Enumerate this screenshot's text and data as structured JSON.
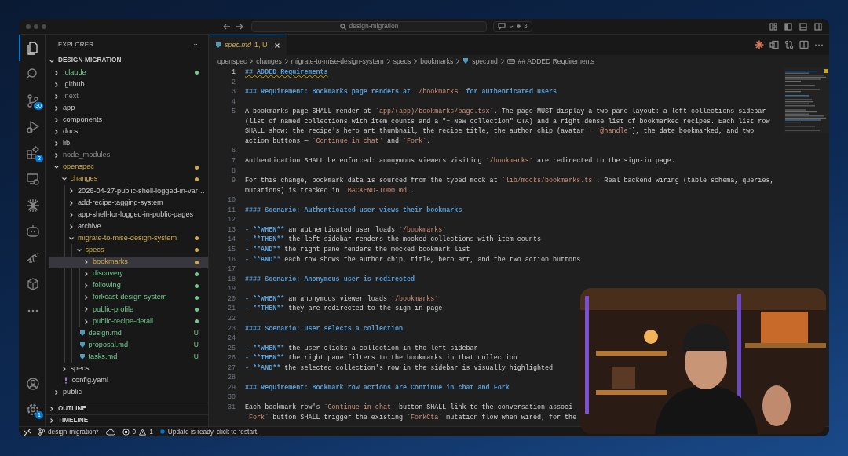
{
  "title_bar": {
    "search": "design-migration",
    "chat_count": "3"
  },
  "activity_bar": {
    "items": [
      {
        "selected": true
      },
      {
        "selected": false
      },
      {
        "selected": false,
        "badge": "30"
      },
      {
        "selected": false
      },
      {
        "selected": false,
        "badge": "2"
      },
      {
        "selected": false
      },
      {
        "selected": false
      },
      {
        "selected": false
      },
      {
        "selected": false
      },
      {
        "selected": false
      },
      {
        "selected": false
      }
    ],
    "bottom": [
      {
        "selected": false
      },
      {
        "selected": false,
        "badge": "1"
      }
    ]
  },
  "sidebar": {
    "title": "EXPLORER",
    "more": "···",
    "sections": [
      {
        "title": "DESIGN-MIGRATION",
        "expanded": true,
        "tree": [
          {
            "label": ".claude",
            "kind": "folder",
            "expanded": false,
            "selected": false,
            "color": "#73c991",
            "dot": true
          },
          {
            "label": ".github",
            "kind": "folder",
            "expanded": false,
            "selected": false
          },
          {
            "label": ".next",
            "kind": "folder",
            "expanded": false,
            "selected": false,
            "dimmed": true
          },
          {
            "label": "app",
            "kind": "folder",
            "expanded": false,
            "selected": false
          },
          {
            "label": "components",
            "kind": "folder",
            "expanded": false,
            "selected": false
          },
          {
            "label": "docs",
            "kind": "folder",
            "expanded": false,
            "selected": false
          },
          {
            "label": "lib",
            "kind": "folder",
            "expanded": false,
            "selected": false
          },
          {
            "label": "node_modules",
            "kind": "folder",
            "expanded": false,
            "selected": false,
            "dimmed": true
          },
          {
            "label": "openspec",
            "kind": "folder",
            "expanded": true,
            "selected": false,
            "color": "#d1ad4f",
            "dot": true,
            "children": [
              {
                "label": "changes",
                "kind": "folder",
                "expanded": true,
                "selected": false,
                "color": "#d1ad4f",
                "dot": true,
                "children": [
                  {
                    "label": "2026-04-27-public-shell-logged-in-var…",
                    "kind": "folder",
                    "expanded": false,
                    "selected": false
                  },
                  {
                    "label": "add-recipe-tagging-system",
                    "kind": "folder",
                    "expanded": false,
                    "selected": false
                  },
                  {
                    "label": "app-shell-for-logged-in-public-pages",
                    "kind": "folder",
                    "expanded": false,
                    "selected": false
                  },
                  {
                    "label": "archive",
                    "kind": "folder",
                    "expanded": false,
                    "selected": false
                  },
                  {
                    "label": "migrate-to-mise-design-system",
                    "kind": "folder",
                    "expanded": true,
                    "selected": false,
                    "color": "#d1ad4f",
                    "dot": true,
                    "children": [
                      {
                        "label": "specs",
                        "kind": "folder",
                        "expanded": true,
                        "selected": false,
                        "color": "#d1ad4f",
                        "dot": true,
                        "children": [
                          {
                            "label": "bookmarks",
                            "kind": "folder",
                            "expanded": false,
                            "selected": true,
                            "color": "#d1ad4f",
                            "dot": true
                          },
                          {
                            "label": "discovery",
                            "kind": "folder",
                            "expanded": false,
                            "selected": false,
                            "color": "#73c991",
                            "dot": true
                          },
                          {
                            "label": "following",
                            "kind": "folder",
                            "expanded": false,
                            "selected": false,
                            "color": "#73c991",
                            "dot": true
                          },
                          {
                            "label": "forkcast-design-system",
                            "kind": "folder",
                            "expanded": false,
                            "selected": false,
                            "color": "#73c991",
                            "dot": true
                          },
                          {
                            "label": "public-profile",
                            "kind": "folder",
                            "expanded": false,
                            "selected": false,
                            "color": "#73c991",
                            "dot": true
                          },
                          {
                            "label": "public-recipe-detail",
                            "kind": "folder",
                            "expanded": false,
                            "selected": false,
                            "color": "#73c991",
                            "dot": true
                          }
                        ]
                      },
                      {
                        "label": "design.md",
                        "kind": "markdown",
                        "selected": false,
                        "badge": "U"
                      },
                      {
                        "label": "proposal.md",
                        "kind": "markdown",
                        "selected": false,
                        "badge": "U"
                      },
                      {
                        "label": "tasks.md",
                        "kind": "markdown",
                        "selected": false,
                        "badge": "U"
                      }
                    ]
                  }
                ]
              },
              {
                "label": "specs",
                "kind": "folder",
                "expanded": false,
                "selected": false
              },
              {
                "label": "config.yaml",
                "kind": "yaml",
                "selected": false
              }
            ]
          },
          {
            "label": "public",
            "kind": "folder",
            "expanded": false,
            "selected": false
          }
        ]
      },
      {
        "title": "OUTLINE",
        "expanded": false
      },
      {
        "title": "TIMELINE",
        "expanded": false
      }
    ]
  },
  "editor": {
    "tabs": [
      {
        "label": "spec.md",
        "status": "1, U",
        "selected": true
      }
    ],
    "breadcrumbs": [
      {
        "label": "openspec",
        "kind": "folder"
      },
      {
        "label": "changes",
        "kind": "folder"
      },
      {
        "label": "migrate-to-mise-design-system",
        "kind": "folder"
      },
      {
        "label": "specs",
        "kind": "folder"
      },
      {
        "label": "bookmarks",
        "kind": "folder"
      },
      {
        "label": "spec.md",
        "kind": "markdown"
      },
      {
        "label": "## ADDED Requirements",
        "kind": "symbol"
      }
    ],
    "lines": [
      {
        "number": "1",
        "current": true,
        "warning": true,
        "rows": [
          {
            "parts": [
              {
                "kind": "heading",
                "text": "## ADDED Requirements"
              }
            ]
          }
        ]
      },
      {
        "number": "2",
        "current": false,
        "rows": [
          {
            "parts": []
          }
        ]
      },
      {
        "number": "3",
        "current": false,
        "rows": [
          {
            "parts": [
              {
                "kind": "heading",
                "text": "### Requirement: Bookmarks page renders at "
              },
              {
                "kind": "code",
                "text": "`/bookmarks`"
              },
              {
                "kind": "heading",
                "text": " for authenticated users"
              }
            ]
          }
        ]
      },
      {
        "number": "4",
        "current": false,
        "rows": [
          {
            "parts": []
          }
        ]
      },
      {
        "number": "5",
        "current": false,
        "rows": [
          {
            "parts": [
              {
                "kind": "text",
                "text": "A bookmarks page SHALL render at "
              },
              {
                "kind": "code",
                "text": "`app/(app)/bookmarks/page.tsx`"
              },
              {
                "kind": "text",
                "text": ". The page MUST display a two-pane layout: a left collections sidebar"
              }
            ]
          },
          {
            "parts": [
              {
                "kind": "text",
                "text": "(list of named collections with item counts and a \"+ New collection\" CTA) and a right dense list of bookmarked recipes. Each list row"
              }
            ]
          },
          {
            "parts": [
              {
                "kind": "text",
                "text": "SHALL show: the recipe's hero art thumbnail, the recipe title, the author chip (avatar + "
              },
              {
                "kind": "code",
                "text": "`@handle`"
              },
              {
                "kind": "text",
                "text": "), the date bookmarked, and two"
              }
            ]
          },
          {
            "parts": [
              {
                "kind": "text",
                "text": "action buttons — "
              },
              {
                "kind": "code",
                "text": "`Continue in chat`"
              },
              {
                "kind": "text",
                "text": " and "
              },
              {
                "kind": "code",
                "text": "`Fork`"
              },
              {
                "kind": "text",
                "text": "."
              }
            ]
          }
        ]
      },
      {
        "number": "6",
        "current": false,
        "rows": [
          {
            "parts": []
          }
        ]
      },
      {
        "number": "7",
        "current": false,
        "rows": [
          {
            "parts": [
              {
                "kind": "text",
                "text": "Authentication SHALL be enforced: anonymous viewers visiting "
              },
              {
                "kind": "code",
                "text": "`/bookmarks`"
              },
              {
                "kind": "text",
                "text": " are redirected to the sign-in page."
              }
            ]
          }
        ]
      },
      {
        "number": "8",
        "current": false,
        "rows": [
          {
            "parts": []
          }
        ]
      },
      {
        "number": "9",
        "current": false,
        "rows": [
          {
            "parts": [
              {
                "kind": "text",
                "text": "For this change, bookmark data is sourced from the typed mock at "
              },
              {
                "kind": "code",
                "text": "`lib/mocks/bookmarks.ts`"
              },
              {
                "kind": "text",
                "text": ". Real backend wiring (table schema, queries,"
              }
            ]
          },
          {
            "parts": [
              {
                "kind": "text",
                "text": "mutations) is tracked in "
              },
              {
                "kind": "code",
                "text": "`BACKEND-TODO.md`"
              },
              {
                "kind": "text",
                "text": "."
              }
            ]
          }
        ]
      },
      {
        "number": "10",
        "current": false,
        "rows": [
          {
            "parts": []
          }
        ]
      },
      {
        "number": "11",
        "current": false,
        "rows": [
          {
            "parts": [
              {
                "kind": "heading",
                "text": "#### Scenario: Authenticated user views their bookmarks"
              }
            ]
          }
        ]
      },
      {
        "number": "12",
        "current": false,
        "rows": [
          {
            "parts": []
          }
        ]
      },
      {
        "number": "13",
        "current": false,
        "rows": [
          {
            "parts": [
              {
                "kind": "marker",
                "text": "- **WHEN**"
              },
              {
                "kind": "text",
                "text": " an authenticated user loads "
              },
              {
                "kind": "code",
                "text": "`/bookmarks`"
              }
            ]
          }
        ]
      },
      {
        "number": "14",
        "current": false,
        "rows": [
          {
            "parts": [
              {
                "kind": "marker",
                "text": "- **THEN**"
              },
              {
                "kind": "text",
                "text": " the left sidebar renders the mocked collections with item counts"
              }
            ]
          }
        ]
      },
      {
        "number": "15",
        "current": false,
        "rows": [
          {
            "parts": [
              {
                "kind": "marker",
                "text": "- **AND**"
              },
              {
                "kind": "text",
                "text": " the right pane renders the mocked bookmark list"
              }
            ]
          }
        ]
      },
      {
        "number": "16",
        "current": false,
        "rows": [
          {
            "parts": [
              {
                "kind": "marker",
                "text": "- **AND**"
              },
              {
                "kind": "text",
                "text": " each row shows the author chip, title, hero art, and the two action buttons"
              }
            ]
          }
        ]
      },
      {
        "number": "17",
        "current": false,
        "rows": [
          {
            "parts": []
          }
        ]
      },
      {
        "number": "18",
        "current": false,
        "rows": [
          {
            "parts": [
              {
                "kind": "heading",
                "text": "#### Scenario: Anonymous user is redirected"
              }
            ]
          }
        ]
      },
      {
        "number": "19",
        "current": false,
        "rows": [
          {
            "parts": []
          }
        ]
      },
      {
        "number": "20",
        "current": false,
        "rows": [
          {
            "parts": [
              {
                "kind": "marker",
                "text": "- **WHEN**"
              },
              {
                "kind": "text",
                "text": " an anonymous viewer loads "
              },
              {
                "kind": "code",
                "text": "`/bookmarks`"
              }
            ]
          }
        ]
      },
      {
        "number": "21",
        "current": false,
        "rows": [
          {
            "parts": [
              {
                "kind": "marker",
                "text": "- **THEN**"
              },
              {
                "kind": "text",
                "text": " they are redirected to the sign-in page"
              }
            ]
          }
        ]
      },
      {
        "number": "22",
        "current": false,
        "rows": [
          {
            "parts": []
          }
        ]
      },
      {
        "number": "23",
        "current": false,
        "rows": [
          {
            "parts": [
              {
                "kind": "heading",
                "text": "#### Scenario: User selects a collection"
              }
            ]
          }
        ]
      },
      {
        "number": "24",
        "current": false,
        "rows": [
          {
            "parts": []
          }
        ]
      },
      {
        "number": "25",
        "current": false,
        "rows": [
          {
            "parts": [
              {
                "kind": "marker",
                "text": "- **WHEN**"
              },
              {
                "kind": "text",
                "text": " the user clicks a collection in the left sidebar"
              }
            ]
          }
        ]
      },
      {
        "number": "26",
        "current": false,
        "rows": [
          {
            "parts": [
              {
                "kind": "marker",
                "text": "- **THEN**"
              },
              {
                "kind": "text",
                "text": " the right pane filters to the bookmarks in that collection"
              }
            ]
          }
        ]
      },
      {
        "number": "27",
        "current": false,
        "rows": [
          {
            "parts": [
              {
                "kind": "marker",
                "text": "- **AND**"
              },
              {
                "kind": "text",
                "text": " the selected collection's row in the sidebar is visually highlighted"
              }
            ]
          }
        ]
      },
      {
        "number": "28",
        "current": false,
        "rows": [
          {
            "parts": []
          }
        ]
      },
      {
        "number": "29",
        "current": false,
        "rows": [
          {
            "parts": [
              {
                "kind": "heading",
                "text": "### Requirement: Bookmark row actions are Continue in chat and Fork"
              }
            ]
          }
        ]
      },
      {
        "number": "30",
        "current": false,
        "rows": [
          {
            "parts": []
          }
        ]
      },
      {
        "number": "31",
        "current": false,
        "rows": [
          {
            "parts": [
              {
                "kind": "text",
                "text": "Each bookmark row's "
              },
              {
                "kind": "code",
                "text": "`Continue in chat`"
              },
              {
                "kind": "text",
                "text": " button SHALL link to the conversation associ"
              }
            ]
          },
          {
            "parts": [
              {
                "kind": "code",
                "text": "`Fork`"
              },
              {
                "kind": "text",
                "text": " button SHALL trigger the existing "
              },
              {
                "kind": "code",
                "text": "`ForkCta`"
              },
              {
                "kind": "text",
                "text": " mutation flow when wired; for the"
              }
            ]
          }
        ]
      }
    ]
  },
  "status_bar": {
    "branch": "design-migration*",
    "errors": "0",
    "warnings": "1",
    "notification": "Update is ready, click to restart."
  }
}
